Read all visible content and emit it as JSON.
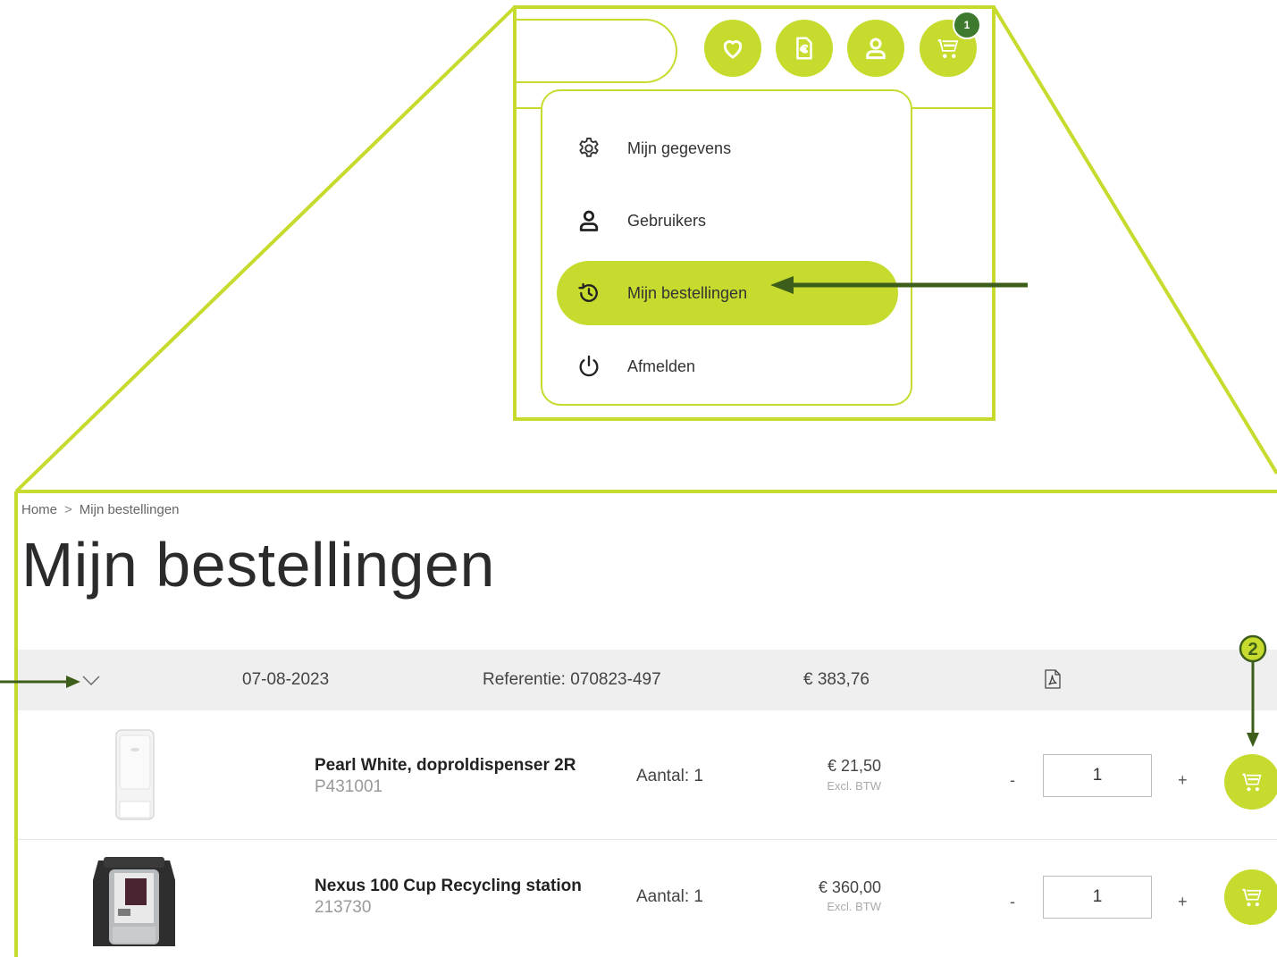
{
  "header": {
    "icons": [
      "heart-icon",
      "euro-document-icon",
      "user-icon",
      "cart-icon"
    ],
    "cart_count": "1"
  },
  "account_menu": {
    "items": [
      {
        "label": "Mijn gegevens",
        "icon": "gear-icon"
      },
      {
        "label": "Gebruikers",
        "icon": "user-icon"
      },
      {
        "label": "Mijn bestellingen",
        "icon": "history-icon",
        "active": true
      },
      {
        "label": "Afmelden",
        "icon": "power-icon"
      }
    ]
  },
  "breadcrumb": {
    "home": "Home",
    "separator": ">",
    "current": "Mijn bestellingen"
  },
  "page": {
    "title": "Mijn bestellingen"
  },
  "order": {
    "date": "07-08-2023",
    "reference": "Referentie: 070823-497",
    "total": "€ 383,76",
    "lines": [
      {
        "name": "Pearl White, doproldispenser 2R",
        "sku": "P431001",
        "qty_label": "Aantal: 1",
        "price": "€ 21,50",
        "price_note": "Excl. BTW",
        "minus": "-",
        "qty_value": "1",
        "plus": "+"
      },
      {
        "name": "Nexus 100 Cup Recycling station",
        "sku": "213730",
        "qty_label": "Aantal: 1",
        "price": "€ 360,00",
        "price_note": "Excl. BTW",
        "minus": "-",
        "qty_value": "1",
        "plus": "+"
      }
    ]
  },
  "annotations": {
    "step2_label": "2"
  },
  "colors": {
    "accent": "#c6db2e",
    "arrow": "#3d5e1a",
    "badge": "#3d7a2e",
    "header_band": "#efefef"
  }
}
